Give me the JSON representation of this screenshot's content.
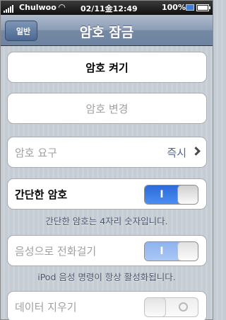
{
  "status_bar": {
    "carrier": "Chulwoo",
    "time": "02/11金12:49",
    "battery": "100%"
  },
  "nav": {
    "back_label": "일반",
    "title": "암호 잠금"
  },
  "cells": {
    "turn_on": "암호 켜기",
    "change": "암호 변경",
    "require_label": "암호 요구",
    "require_value": "즉시",
    "simple_label": "간단한 암호",
    "simple_toggle": "I",
    "simple_footer": "간단한 암호는 4자리 숫자입니다.",
    "voice_label": "음성으로 전화걸기",
    "voice_toggle": "I",
    "voice_footer": "iPod 음성 명령이 항상 활성화됩니다.",
    "erase_label": "데이터 지우기"
  },
  "state": {
    "simple_passcode_on": true,
    "voice_dial_on": true,
    "erase_data_on": false
  },
  "colors": {
    "accent": "#3478e6",
    "nav_bar": "#7a8fac",
    "detail_text": "#4e6690"
  }
}
